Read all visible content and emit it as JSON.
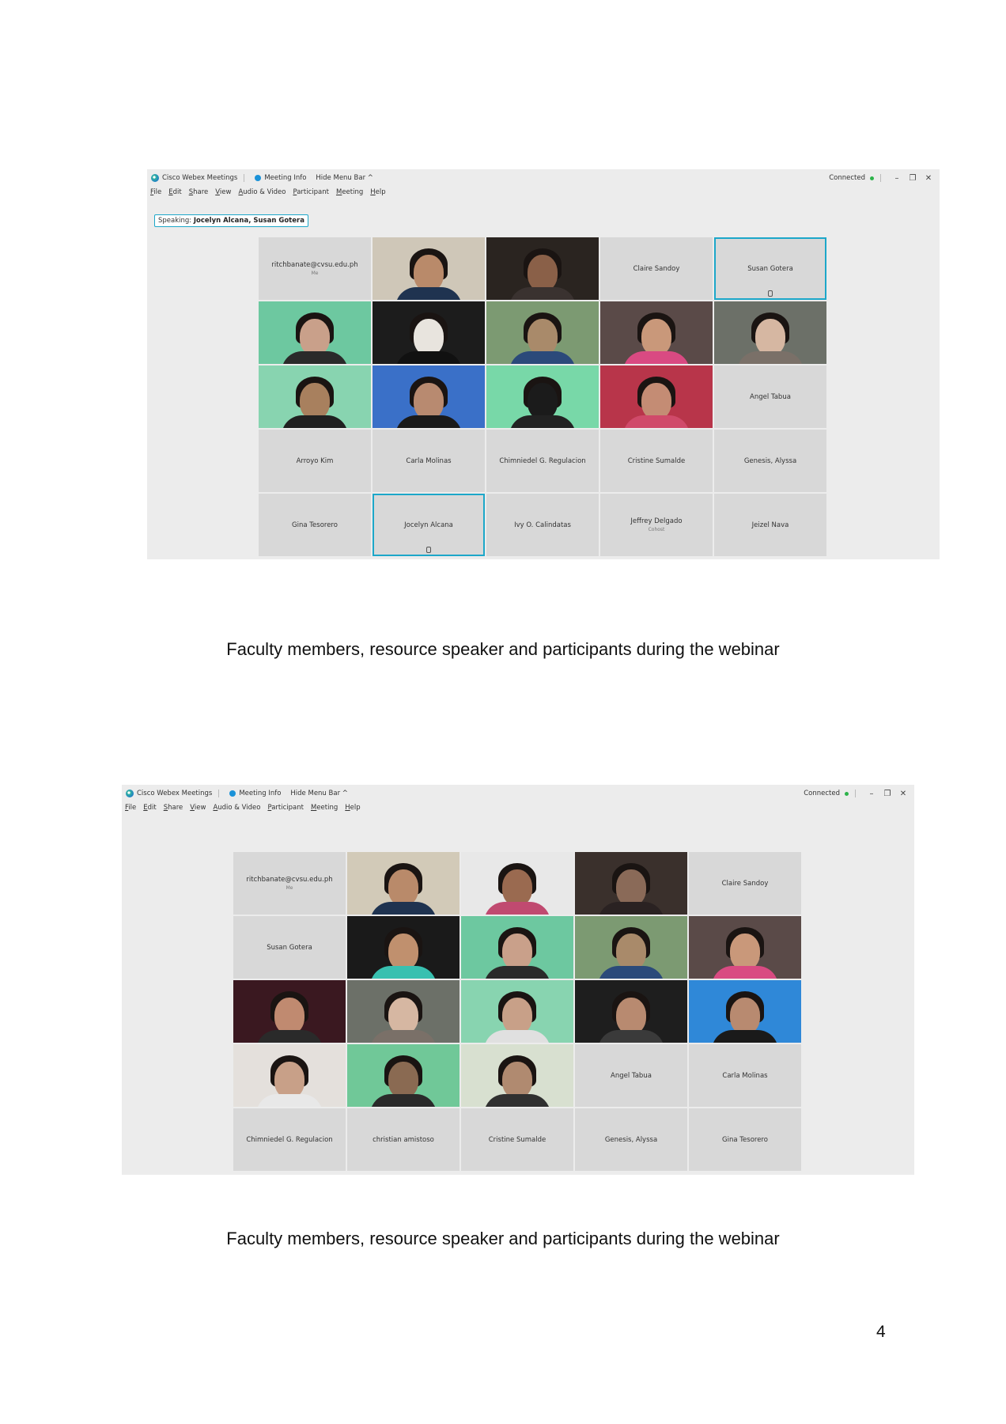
{
  "screenshots": [
    {
      "app_title": "Cisco Webex Meetings",
      "meeting_info": "Meeting Info",
      "hide_menu": "Hide Menu Bar ^",
      "status": "Connected",
      "menu": [
        "File",
        "Edit",
        "Share",
        "View",
        "Audio & Video",
        "Participant",
        "Meeting",
        "Help"
      ],
      "speaking_label": "Speaking:",
      "speaking_names": "Jocelyn Alcana, Susan Gotera",
      "tiles": [
        {
          "type": "name",
          "name": "ritchbanate@cvsu.edu.ph",
          "sub": "Me"
        },
        {
          "type": "video",
          "bg": "#cfc7b8",
          "skin": "#b98a6a",
          "shirt": "#1f3350"
        },
        {
          "type": "video",
          "bg": "#2a2420",
          "skin": "#8a6048",
          "shirt": "#3a3230"
        },
        {
          "type": "name",
          "name": "Claire Sandoy"
        },
        {
          "type": "name",
          "name": "Susan Gotera",
          "active": true,
          "mic": true
        },
        {
          "type": "video",
          "bg": "#6dc8a0",
          "skin": "#c9a08a",
          "shirt": "#2a2a2a"
        },
        {
          "type": "video",
          "bg": "#1c1c1c",
          "skin": "#e8e4de",
          "shirt": "#111111"
        },
        {
          "type": "video",
          "bg": "#7c9a72",
          "skin": "#a98a6a",
          "shirt": "#2b4a7a"
        },
        {
          "type": "video",
          "bg": "#5a4a48",
          "skin": "#c9987a",
          "shirt": "#d94a82"
        },
        {
          "type": "video",
          "bg": "#6c7068",
          "skin": "#d6b7a2",
          "shirt": "#7a7068"
        },
        {
          "type": "video",
          "bg": "#88d4b0",
          "skin": "#a8805e",
          "shirt": "#202020"
        },
        {
          "type": "video",
          "bg": "#3a70c8",
          "skin": "#b88a70",
          "shirt": "#1a1a1a"
        },
        {
          "type": "video",
          "bg": "#78d8a8",
          "skin": "#1b1b1b",
          "shirt": "#222222"
        },
        {
          "type": "video",
          "bg": "#b8354a",
          "skin": "#c48c74",
          "shirt": "#d04a6a"
        },
        {
          "type": "name",
          "name": "Angel Tabua"
        },
        {
          "type": "name",
          "name": "Arroyo Kim"
        },
        {
          "type": "name",
          "name": "Carla Molinas"
        },
        {
          "type": "name",
          "name": "Chimniedel G. Regulacion"
        },
        {
          "type": "name",
          "name": "Cristine Sumalde"
        },
        {
          "type": "name",
          "name": "Genesis, Alyssa"
        },
        {
          "type": "name",
          "name": "Gina Tesorero"
        },
        {
          "type": "name",
          "name": "Jocelyn Alcana",
          "active": true,
          "mic": true
        },
        {
          "type": "name",
          "name": "Ivy O. Calindatas"
        },
        {
          "type": "name",
          "name": "Jeffrey Delgado",
          "sub": "Cohost"
        },
        {
          "type": "name",
          "name": "Jeizel Nava"
        }
      ],
      "caption": "Faculty members, resource speaker and participants during the webinar"
    },
    {
      "app_title": "Cisco Webex Meetings",
      "meeting_info": "Meeting Info",
      "hide_menu": "Hide Menu Bar ^",
      "status": "Connected",
      "menu": [
        "File",
        "Edit",
        "Share",
        "View",
        "Audio & Video",
        "Participant",
        "Meeting",
        "Help"
      ],
      "tiles": [
        {
          "type": "name",
          "name": "ritchbanate@cvsu.edu.ph",
          "sub": "Me"
        },
        {
          "type": "video",
          "bg": "#d2cab8",
          "skin": "#b98a6a",
          "shirt": "#1f3350"
        },
        {
          "type": "video",
          "bg": "#e8e8e8",
          "skin": "#9a6a50",
          "shirt": "#c04a70"
        },
        {
          "type": "video",
          "bg": "#3a302c",
          "skin": "#8a6a58",
          "shirt": "#2a2222"
        },
        {
          "type": "name",
          "name": "Claire Sandoy"
        },
        {
          "type": "name",
          "name": "Susan Gotera"
        },
        {
          "type": "video",
          "bg": "#1a1a1a",
          "skin": "#c0906e",
          "shirt": "#38c0b0"
        },
        {
          "type": "video",
          "bg": "#6dc8a0",
          "skin": "#c9a08a",
          "shirt": "#2a2a2a"
        },
        {
          "type": "video",
          "bg": "#7c9a72",
          "skin": "#a98a6a",
          "shirt": "#2b4a7a"
        },
        {
          "type": "video",
          "bg": "#5a4a48",
          "skin": "#c9987a",
          "shirt": "#d94a82"
        },
        {
          "type": "video",
          "bg": "#3a1820",
          "skin": "#c08a70",
          "shirt": "#2a2a2a"
        },
        {
          "type": "video",
          "bg": "#6c7068",
          "skin": "#d6b7a2",
          "shirt": "#7a7068"
        },
        {
          "type": "video",
          "bg": "#88d4b0",
          "skin": "#c8a088",
          "shirt": "#e0e0e0"
        },
        {
          "type": "video",
          "bg": "#1e1e1e",
          "skin": "#b88a70",
          "shirt": "#3a3a3a"
        },
        {
          "type": "video",
          "bg": "#2f88d8",
          "skin": "#b88a70",
          "shirt": "#1a1a1a"
        },
        {
          "type": "video",
          "bg": "#e4e0dc",
          "skin": "#c8a088",
          "shirt": "#e8e8e8"
        },
        {
          "type": "video",
          "bg": "#70c898",
          "skin": "#8a6a52",
          "shirt": "#2a2a2a"
        },
        {
          "type": "video",
          "bg": "#d8e0d0",
          "skin": "#b08a70",
          "shirt": "#303030"
        },
        {
          "type": "name",
          "name": "Angel Tabua"
        },
        {
          "type": "name",
          "name": "Carla Molinas"
        },
        {
          "type": "name",
          "name": "Chimniedel G. Regulacion"
        },
        {
          "type": "name",
          "name": "christian amistoso"
        },
        {
          "type": "name",
          "name": "Cristine Sumalde"
        },
        {
          "type": "name",
          "name": "Genesis, Alyssa"
        },
        {
          "type": "name",
          "name": "Gina Tesorero"
        }
      ],
      "caption": "Faculty members, resource speaker and participants during the webinar"
    }
  ],
  "page_number": "4"
}
